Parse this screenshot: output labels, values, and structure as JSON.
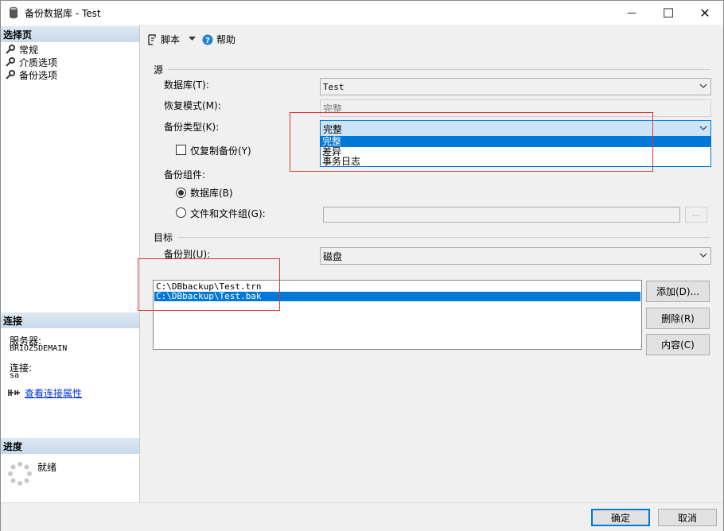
{
  "window": {
    "title": "备份数据库 - Test",
    "minimize_glyph": "—",
    "maximize_glyph": "☐",
    "close_glyph": "✕"
  },
  "left_panel": {
    "select_page_header": "选择页",
    "pages": [
      {
        "label": "常规",
        "icon": "wrench-icon"
      },
      {
        "label": "介质选项",
        "icon": "wrench-icon"
      },
      {
        "label": "备份选项",
        "icon": "wrench-icon"
      }
    ],
    "connection_header": "连接",
    "server_label": "服务器:",
    "server_value": "BRIOZSDEMAIN",
    "connection_label": "连接:",
    "connection_value": "sa",
    "view_conn_props": "查看连接属性",
    "progress_header": "进度",
    "progress_status": "就绪"
  },
  "toolbar": {
    "script_label": "脚本",
    "help_label": "帮助"
  },
  "source": {
    "group_label": "源",
    "database_label": "数据库(T):",
    "database_value": "Test",
    "recovery_label": "恢复模式(M):",
    "recovery_value": "完整",
    "backup_type_label": "备份类型(K):",
    "backup_type_value": "完整",
    "backup_type_options": [
      "完整",
      "差异",
      "事务日志"
    ],
    "copy_only_label": "仅复制备份(Y)",
    "component_label": "备份组件:",
    "radio_database": "数据库(B)",
    "radio_files": "文件和文件组(G):",
    "files_browse_label": "..."
  },
  "destination": {
    "group_label": "目标",
    "backup_to_label": "备份到(U):",
    "backup_to_value": "磁盘",
    "paths": [
      "C:\\DBbackup\\Test.trn",
      "C:\\DBbackup\\Test.bak"
    ],
    "add_button": "添加(D)...",
    "remove_button": "删除(R)",
    "contents_button": "内容(C)"
  },
  "footer": {
    "ok_button": "确定",
    "cancel_button": "取消"
  },
  "colors": {
    "selection": "#0078d7",
    "annotation_box": "#e53333",
    "section_header": "#c9d9ea"
  }
}
